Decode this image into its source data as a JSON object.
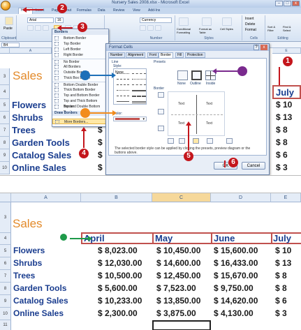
{
  "window": {
    "title": "Nursery Sales 2008.xlsx - Microsoft Excel",
    "buttons": [
      "–",
      "□",
      "x"
    ]
  },
  "ribbon_tabs": [
    "Home",
    "Insert",
    "Page Layout",
    "Formulas",
    "Data",
    "Review",
    "View",
    "Add-Ins"
  ],
  "ribbon": {
    "font_name": "Arial",
    "font_size": "16",
    "number_format": "Currency",
    "groups": [
      "Clipboard",
      "Font",
      "Number",
      "Styles",
      "Cells",
      "Editing"
    ],
    "paste_label": "Paste",
    "conditional_formatting": "Conditional Formatting",
    "format_as_table": "Format as Table",
    "cell_styles": "Cell Styles",
    "insert": "Insert",
    "delete": "Delete",
    "format": "Format",
    "sort_filter": "Sort & Filter",
    "find_select": "Find & Select"
  },
  "name_box": "B4",
  "top_sheet": {
    "columns": [
      "A",
      "B",
      "C",
      "D",
      "E"
    ],
    "rows": [
      "3",
      "4",
      "5",
      "6",
      "7",
      "8",
      "9",
      "10",
      "11"
    ],
    "title": "Sales",
    "labels": [
      "Flowers",
      "Shrubs",
      "Trees",
      "Garden Tools",
      "Catalog Sales",
      "Online Sales"
    ],
    "col_e_header": "July",
    "col_e_values": [
      "$ 10",
      "$ 13",
      "$ 8",
      "$ 8",
      "$ 6",
      "$ 3"
    ],
    "partial_values": [
      "$",
      "$",
      "$",
      "$",
      "$",
      "$"
    ]
  },
  "border_menu": {
    "header": "Borders",
    "items": [
      "Bottom Border",
      "Top Border",
      "Left Border",
      "Right Border",
      "No Border",
      "All Borders",
      "Outside Borders",
      "Thick Box Border",
      "Bottom Double Border",
      "Thick Bottom Border",
      "Top and Bottom Border",
      "Top and Thick Bottom Border",
      "Top and Double Bottom Border",
      "Draw Borders",
      "More Borders..."
    ]
  },
  "format_cells": {
    "title": "Format Cells",
    "tabs": [
      "Number",
      "Alignment",
      "Font",
      "Border",
      "Fill",
      "Protection"
    ],
    "line_group": "Line",
    "style_label": "Style:",
    "style_none": "None",
    "color_label": "Color:",
    "presets_group": "Presets",
    "presets": [
      "None",
      "Outline",
      "Inside"
    ],
    "border_group": "Border",
    "preview_text": "Text",
    "note": "The selected border style can be applied by clicking the presets, preview diagram or the buttons above.",
    "ok": "OK",
    "cancel": "Cancel",
    "help": "?",
    "close": "x"
  },
  "callouts": {
    "step1": "1",
    "step2": "2",
    "step3": "3",
    "step4": "4",
    "step5": "5",
    "step6": "6"
  },
  "bottom_sheet": {
    "columns": [
      "A",
      "B",
      "C",
      "D",
      "E"
    ],
    "rows": [
      "3",
      "4",
      "5",
      "6",
      "7",
      "8",
      "9",
      "10",
      "11"
    ],
    "title": "Sales",
    "months": [
      "April",
      "May",
      "June",
      "July"
    ],
    "rows_data": [
      {
        "label": "Flowers",
        "values": [
          "$ 8,023.00",
          "$ 10,450.00",
          "$ 15,600.00",
          "$ 10"
        ]
      },
      {
        "label": "Shrubs",
        "values": [
          "$ 12,030.00",
          "$ 14,600.00",
          "$ 16,433.00",
          "$ 13"
        ]
      },
      {
        "label": "Trees",
        "values": [
          "$ 10,500.00",
          "$ 12,450.00",
          "$ 15,670.00",
          "$ 8"
        ]
      },
      {
        "label": "Garden Tools",
        "values": [
          "$ 5,600.00",
          "$ 7,523.00",
          "$ 9,750.00",
          "$ 8"
        ]
      },
      {
        "label": "Catalog Sales",
        "values": [
          "$ 10,233.00",
          "$ 13,850.00",
          "$ 14,620.00",
          "$ 6"
        ]
      },
      {
        "label": "Online Sales",
        "values": [
          "$ 2,300.00",
          "$ 3,875.00",
          "$ 4,130.00",
          "$ 3"
        ]
      }
    ]
  },
  "colors": {
    "accent_red": "#c4161c",
    "title_orange": "#e38a2a",
    "label_blue": "#1a3d8f",
    "border_red": "#c0504d"
  }
}
